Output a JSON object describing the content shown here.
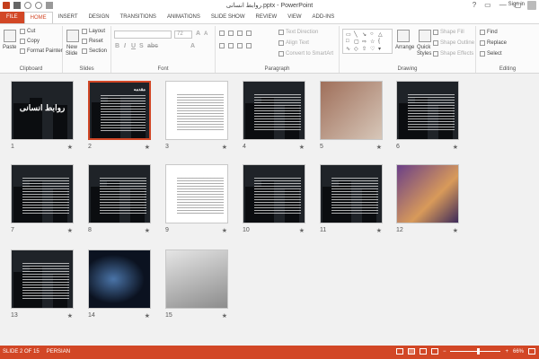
{
  "window": {
    "title": "روابط انسانی.pptx - PowerPoint",
    "controls": [
      "?",
      "▭",
      "—",
      "▢",
      "✕"
    ]
  },
  "quick_access": {
    "icons": [
      "powerpoint-logo-icon",
      "save-icon",
      "undo-icon",
      "redo-icon",
      "present-icon"
    ]
  },
  "tabs": [
    "FILE",
    "HOME",
    "INSERT",
    "DESIGN",
    "TRANSITIONS",
    "ANIMATIONS",
    "SLIDE SHOW",
    "REVIEW",
    "VIEW",
    "ADD-INS"
  ],
  "active_tab": "HOME",
  "account": {
    "signin": "Sign in"
  },
  "ribbon": {
    "clipboard": {
      "label": "Clipboard",
      "paste": "Paste",
      "cut": "Cut",
      "copy": "Copy",
      "format_painter": "Format Painter"
    },
    "slides": {
      "label": "Slides",
      "new_slide": "New",
      "new_slide2": "Slide",
      "layout": "Layout",
      "reset": "Reset",
      "section": "Section"
    },
    "font": {
      "label": "Font",
      "font_name": "",
      "font_size": "72"
    },
    "paragraph": {
      "label": "Paragraph",
      "text_direction": "Text Direction",
      "align_text": "Align Text",
      "convert": "Convert to SmartArt"
    },
    "drawing": {
      "label": "Drawing",
      "arrange": "Arrange",
      "quick_styles": "Quick",
      "quick_styles2": "Styles",
      "shape_fill": "Shape Fill",
      "shape_outline": "Shape Outline",
      "shape_effects": "Shape Effects"
    },
    "editing": {
      "label": "Editing",
      "find": "Find",
      "replace": "Replace",
      "select": "Select"
    }
  },
  "slides": [
    {
      "num": "1",
      "style": "title",
      "text": "روابط انسانی",
      "selected": false
    },
    {
      "num": "2",
      "style": "text",
      "text": "مقدمه",
      "selected": true
    },
    {
      "num": "3",
      "style": "light",
      "text": "",
      "selected": false
    },
    {
      "num": "4",
      "style": "text",
      "text": "",
      "selected": false
    },
    {
      "num": "5",
      "style": "photo",
      "text": "",
      "selected": false
    },
    {
      "num": "6",
      "style": "text",
      "text": "",
      "selected": false
    },
    {
      "num": "7",
      "style": "text",
      "text": "",
      "selected": false
    },
    {
      "num": "8",
      "style": "text",
      "text": "",
      "selected": false
    },
    {
      "num": "9",
      "style": "light",
      "text": "",
      "selected": false
    },
    {
      "num": "10",
      "style": "text",
      "text": "",
      "selected": false
    },
    {
      "num": "11",
      "style": "text",
      "text": "",
      "selected": false
    },
    {
      "num": "12",
      "style": "meeting",
      "text": "",
      "selected": false
    },
    {
      "num": "13",
      "style": "text",
      "text": "",
      "selected": false
    },
    {
      "num": "14",
      "style": "smoke",
      "text": "",
      "selected": false
    },
    {
      "num": "15",
      "style": "laptop",
      "text": "",
      "selected": false
    }
  ],
  "slide_star": "★",
  "status": {
    "slide_info": "SLIDE 2 OF 15",
    "language": "PERSIAN",
    "zoom": "66%",
    "zoom_minus": "−",
    "zoom_plus": "+"
  },
  "colors": {
    "accent": "#d24726",
    "selected_border": "#d24726"
  }
}
